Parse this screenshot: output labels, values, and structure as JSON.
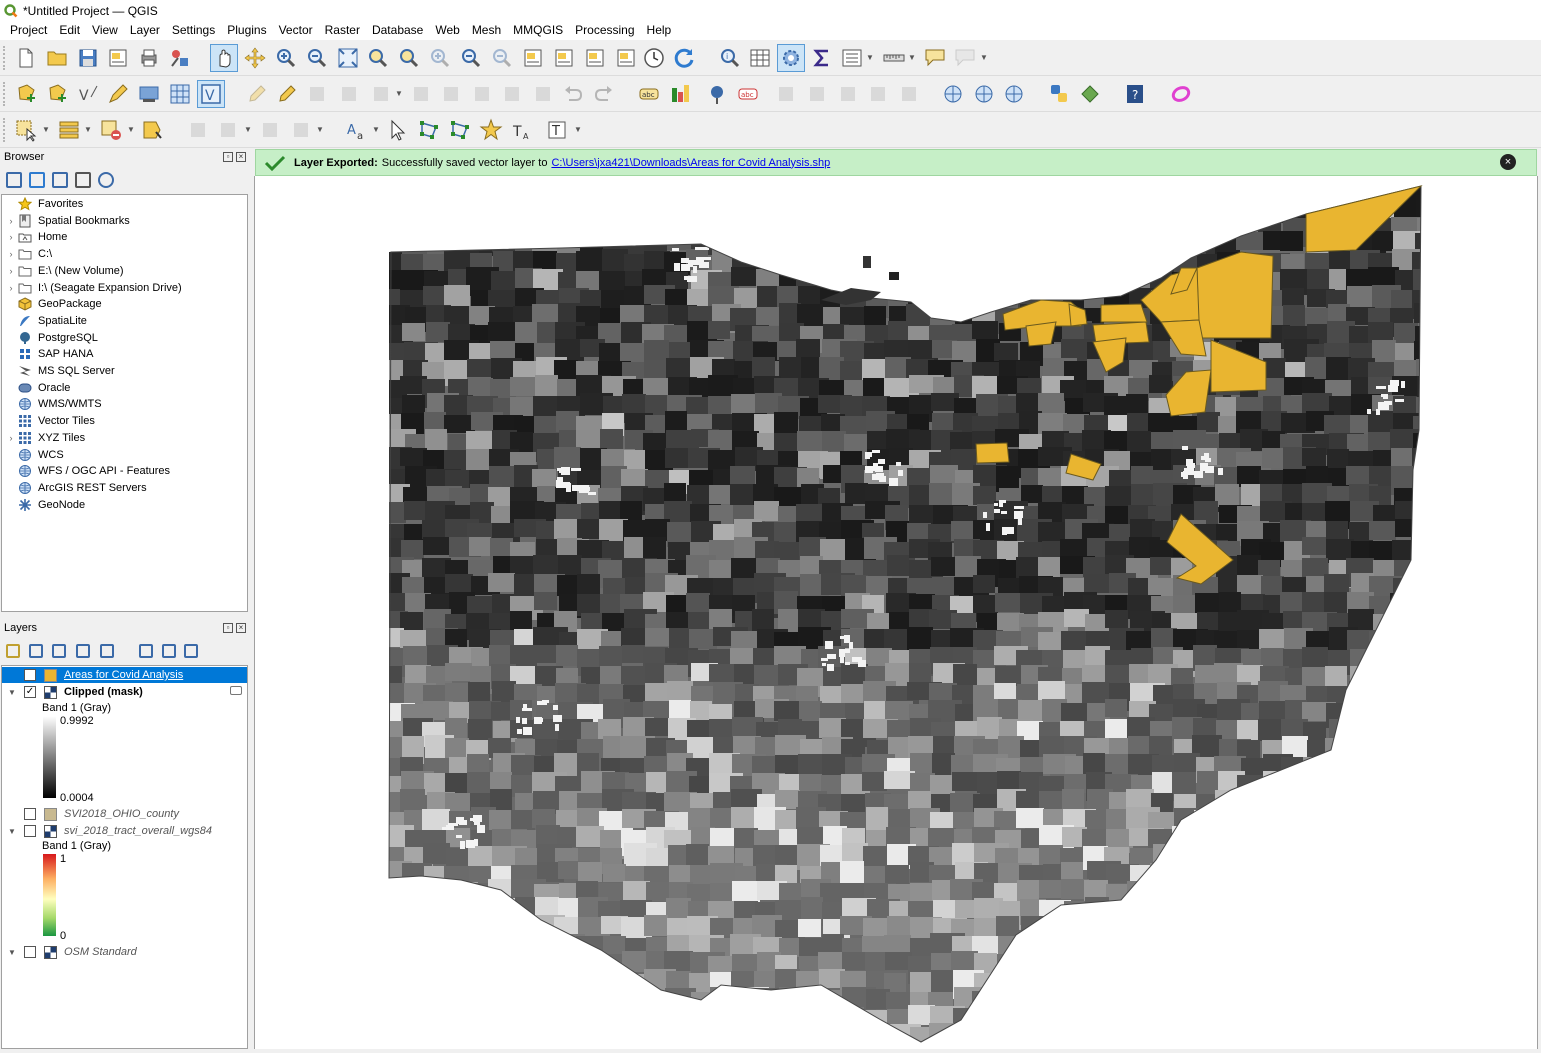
{
  "window": {
    "title": "*Untitled Project — QGIS"
  },
  "menubar": {
    "items": [
      "Project",
      "Edit",
      "View",
      "Layer",
      "Settings",
      "Plugins",
      "Vector",
      "Raster",
      "Database",
      "Web",
      "Mesh",
      "MMQGIS",
      "Processing",
      "Help"
    ]
  },
  "browser": {
    "title": "Browser",
    "items": [
      {
        "label": "Favorites",
        "icon": "star-icon",
        "expand": false
      },
      {
        "label": "Spatial Bookmarks",
        "icon": "bookmark-icon",
        "expand": true
      },
      {
        "label": "Home",
        "icon": "home-folder-icon",
        "expand": true
      },
      {
        "label": "C:\\",
        "icon": "folder-icon",
        "expand": true
      },
      {
        "label": "E:\\ (New Volume)",
        "icon": "folder-icon",
        "expand": true
      },
      {
        "label": "I:\\ (Seagate Expansion Drive)",
        "icon": "folder-icon",
        "expand": true
      },
      {
        "label": "GeoPackage",
        "icon": "geopackage-icon",
        "expand": false
      },
      {
        "label": "SpatiaLite",
        "icon": "spatialite-icon",
        "expand": false
      },
      {
        "label": "PostgreSQL",
        "icon": "postgresql-icon",
        "expand": false
      },
      {
        "label": "SAP HANA",
        "icon": "sap-hana-icon",
        "expand": false
      },
      {
        "label": "MS SQL Server",
        "icon": "mssql-icon",
        "expand": false
      },
      {
        "label": "Oracle",
        "icon": "oracle-icon",
        "expand": false
      },
      {
        "label": "WMS/WMTS",
        "icon": "globe-icon",
        "expand": false
      },
      {
        "label": "Vector Tiles",
        "icon": "grid-icon",
        "expand": false
      },
      {
        "label": "XYZ Tiles",
        "icon": "grid-icon",
        "expand": true
      },
      {
        "label": "WCS",
        "icon": "globe-icon",
        "expand": false
      },
      {
        "label": "WFS / OGC API - Features",
        "icon": "globe-icon",
        "expand": false
      },
      {
        "label": "ArcGIS REST Servers",
        "icon": "globe-icon",
        "expand": false
      },
      {
        "label": "GeoNode",
        "icon": "geonode-icon",
        "expand": false
      }
    ]
  },
  "layers": {
    "title": "Layers",
    "selected_layer": "Areas for Covid Analysis",
    "clipped_layer": "Clipped (mask)",
    "clipped_band": "Band 1 (Gray)",
    "clipped_max": "0.9992",
    "clipped_min": "0.0004",
    "county_layer": "SVI2018_OHIO_county",
    "tract_layer": "svi_2018_tract_overall_wgs84",
    "tract_band": "Band 1 (Gray)",
    "tract_max": "1",
    "tract_min": "0",
    "osm_layer": "OSM Standard"
  },
  "message": {
    "bold": "Layer Exported:",
    "text": "Successfully saved vector layer to",
    "link": "C:\\Users\\jxa421\\Downloads\\Areas for Covid Analysis.shp"
  },
  "colors": {
    "highlight": "#e9b530",
    "selection_bg": "#0078d7",
    "message_bg": "#c6efc7"
  }
}
